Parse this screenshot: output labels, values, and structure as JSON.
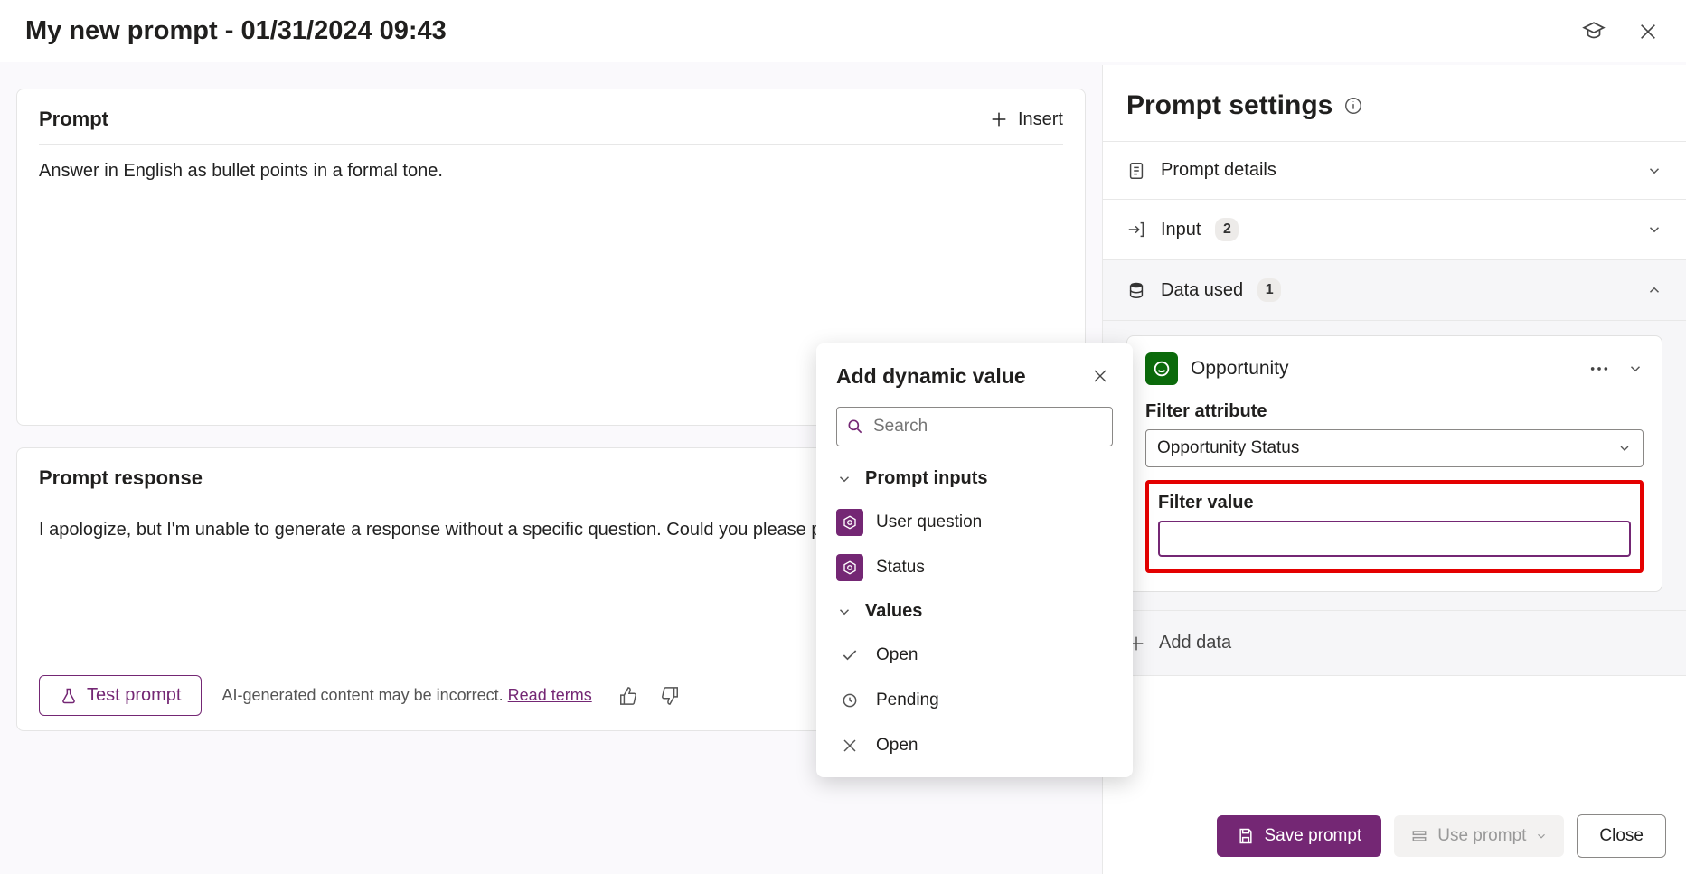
{
  "header": {
    "title": "My new prompt - 01/31/2024 09:43"
  },
  "prompt_card": {
    "title": "Prompt",
    "insert_label": "Insert",
    "body": "Answer in English as bullet points in a formal tone."
  },
  "response_card": {
    "title": "Prompt response",
    "body": "I apologize, but I'm unable to generate a response without a specific question. Could you please provide more de",
    "test_label": "Test prompt",
    "disclaimer": "AI-generated content may be incorrect.",
    "read_terms": "Read terms"
  },
  "popover": {
    "title": "Add dynamic value",
    "search_placeholder": "Search",
    "groups": {
      "inputs_label": "Prompt inputs",
      "values_label": "Values"
    },
    "inputs": [
      {
        "label": "User question"
      },
      {
        "label": "Status"
      }
    ],
    "values": [
      {
        "label": "Open",
        "icon": "check"
      },
      {
        "label": "Pending",
        "icon": "clock"
      },
      {
        "label": "Open",
        "icon": "x"
      }
    ]
  },
  "settings": {
    "title": "Prompt settings",
    "sections": {
      "details_label": "Prompt details",
      "input_label": "Input",
      "input_count": "2",
      "data_label": "Data used",
      "data_count": "1"
    },
    "entity": {
      "name": "Opportunity",
      "filter_attr_label": "Filter attribute",
      "filter_attr_value": "Opportunity Status",
      "filter_value_label": "Filter value",
      "filter_value": ""
    },
    "add_data_label": "Add data"
  },
  "footer": {
    "save_label": "Save prompt",
    "use_label": "Use prompt",
    "close_label": "Close"
  }
}
